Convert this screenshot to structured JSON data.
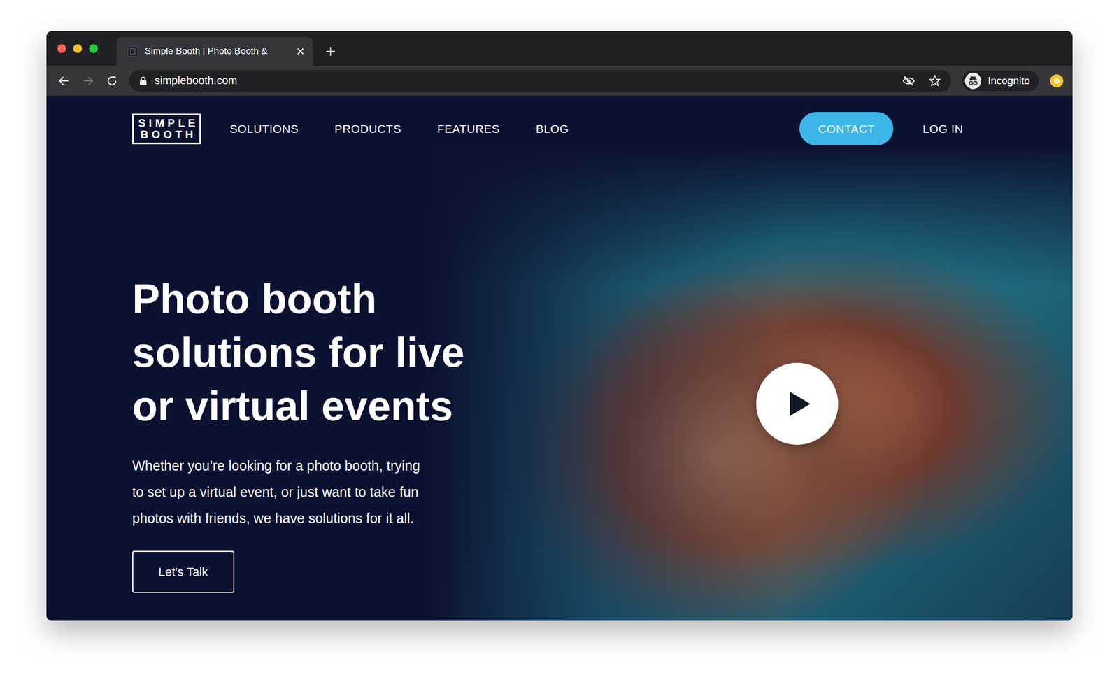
{
  "window": {
    "tab": {
      "title": "Simple Booth | Photo Booth &",
      "selected": true
    },
    "address": "simplebooth.com",
    "profile": "Incognito",
    "back_enabled": true,
    "forward_enabled": false
  },
  "nav": {
    "logo": [
      "SIMPLE",
      "BOOTH"
    ],
    "links": [
      "SOLUTIONS",
      "PRODUCTS",
      "FEATURES",
      "BLOG"
    ],
    "contact": "CONTACT",
    "login": "LOG IN"
  },
  "hero": {
    "headline": [
      "Photo booth",
      "solutions for live",
      "or virtual events"
    ],
    "lead": [
      "Whether you’re looking for a photo booth, trying",
      "to set up a virtual event, or just want to take fun",
      "photos with friends, we have solutions for it all."
    ],
    "cta": "Let's Talk"
  }
}
